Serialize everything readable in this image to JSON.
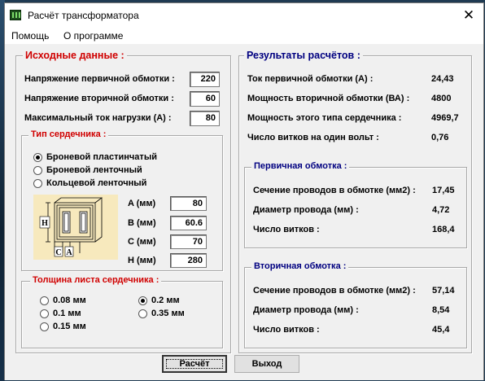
{
  "window": {
    "title": "Расчёт трансформатора",
    "close_glyph": "✕"
  },
  "menu": [
    "Помощь",
    "О программе"
  ],
  "input": {
    "title": "Исходные данные :",
    "rows": [
      {
        "label": "Напряжение первичной обмотки :",
        "value": "220"
      },
      {
        "label": "Напряжение вторичной обмотки :",
        "value": "60"
      },
      {
        "label": "Максимальный ток нагрузки  (А) :",
        "value": "80"
      }
    ],
    "core_type": {
      "title": "Тип сердечника :",
      "options": [
        {
          "label": "Броневой пластинчатый",
          "selected": true
        },
        {
          "label": "Броневой ленточный",
          "selected": false
        },
        {
          "label": "Кольцевой ленточный",
          "selected": false
        }
      ],
      "diagram_labels": {
        "h": "H",
        "c": "C",
        "a": "A"
      },
      "dims": [
        {
          "label": "A (мм)",
          "value": "80"
        },
        {
          "label": "B (мм)",
          "value": "60.6"
        },
        {
          "label": "C (мм)",
          "value": "70"
        },
        {
          "label": "H (мм)",
          "value": "280"
        }
      ]
    },
    "sheet": {
      "title": "Толщина листа сердечника :",
      "options": [
        {
          "label": "0.08 мм",
          "selected": false
        },
        {
          "label": "0.1 мм",
          "selected": false
        },
        {
          "label": "0.15 мм",
          "selected": false
        },
        {
          "label": "0.2 мм",
          "selected": true
        },
        {
          "label": "0.35 мм",
          "selected": false
        }
      ]
    }
  },
  "results": {
    "title": "Результаты расчётов :",
    "rows": [
      {
        "label": "Ток первичной обмотки (А) :",
        "value": "24,43"
      },
      {
        "label": "Мощность вторичной обмотки (ВА) :",
        "value": "4800"
      },
      {
        "label": "Мощность  этого типа сердечника :",
        "value": "4969,7"
      },
      {
        "label": "Число витков на один вольт :",
        "value": "0,76"
      }
    ],
    "primary": {
      "title": "Первичная обмотка :",
      "rows": [
        {
          "label": "Сечение проводов в обмотке (мм2) :",
          "value": "17,45"
        },
        {
          "label": "Диаметр провода (мм) :",
          "value": "4,72"
        },
        {
          "label": "Число витков :",
          "value": "168,4"
        }
      ]
    },
    "secondary": {
      "title": "Вторичная обмотка :",
      "rows": [
        {
          "label": "Сечение проводов в обмотке (мм2) :",
          "value": "57,14"
        },
        {
          "label": "Диаметр провода (мм) :",
          "value": "8,54"
        },
        {
          "label": "Число витков :",
          "value": "45,4"
        }
      ]
    }
  },
  "buttons": {
    "calc": "Расчёт",
    "exit": "Выход"
  }
}
